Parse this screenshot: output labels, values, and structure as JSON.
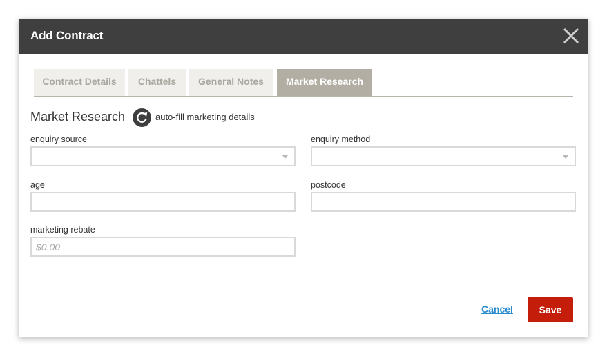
{
  "modal": {
    "title": "Add Contract",
    "close_icon": "close-icon"
  },
  "tabs": [
    {
      "label": "Contract Details",
      "active": false
    },
    {
      "label": "Chattels",
      "active": false
    },
    {
      "label": "General Notes",
      "active": false
    },
    {
      "label": "Market Research",
      "active": true
    }
  ],
  "section": {
    "title": "Market Research",
    "autofill_icon": "refresh-icon",
    "autofill_label": "auto-fill marketing details"
  },
  "form": {
    "enquiry_source": {
      "label": "enquiry source",
      "value": ""
    },
    "enquiry_method": {
      "label": "enquiry method",
      "value": ""
    },
    "age": {
      "label": "age",
      "value": ""
    },
    "postcode": {
      "label": "postcode",
      "value": ""
    },
    "marketing_rebate": {
      "label": "marketing rebate",
      "value": "",
      "placeholder": "$0.00"
    }
  },
  "footer": {
    "cancel_label": "Cancel",
    "save_label": "Save"
  },
  "colors": {
    "header_bg": "#3f3f3f",
    "tab_active_bg": "#b2aea4",
    "tab_inactive_bg": "#f0efeb",
    "save_bg": "#c41e0b",
    "link": "#2a8ccf"
  }
}
